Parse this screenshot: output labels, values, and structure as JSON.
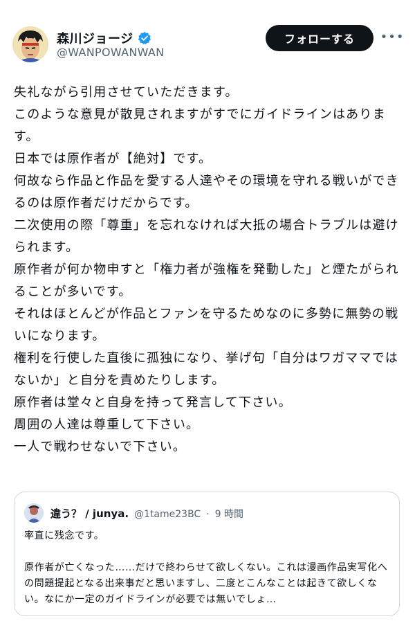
{
  "author": {
    "display_name": "森川ジョージ",
    "handle": "@WANPOWANWAN",
    "verified": true
  },
  "actions": {
    "follow_label": "フォローする",
    "more_label": "•••"
  },
  "post": {
    "lines": [
      "失礼ながら引用させていただきます。",
      "このような意見が散見されますがすでにガイドラインはあります。",
      "日本では原作者が【絶対】です。",
      "何故なら作品と作品を愛する人達やその環境を守れる戦いができるのは原作者だけだからです。",
      "二次使用の際「尊重」を忘れなければ大抵の場合トラブルは避けられます。",
      "原作者が何か物申すと「権力者が強権を発動した」と煙たがられることが多いです。",
      "それはほとんどが作品とファンを守るためなのに多勢に無勢の戦いになります。",
      "権利を行使した直後に孤独になり、挙げ句「自分はワガママではないか」と自分を責めたりします。",
      "原作者は堂々と自身を持って発言して下さい。",
      "周囲の人達は尊重して下さい。",
      "一人で戦わせないで下さい。"
    ]
  },
  "quote": {
    "display_name": "違う？ / junya.",
    "handle": "@1tame23BC",
    "separator": "·",
    "time": "9 時間",
    "line1": "率直に残念です。",
    "line2": "原作者が亡くなった……だけで終わらせて欲しくない。これは漫画作品実写化への問題提起となる出来事だと思いますし、二度とこんなことは起きて欲しくない。なにか一定のガイドラインが必要では無いでしょ…"
  },
  "colors": {
    "text": "#0f1419",
    "secondary": "#536471",
    "verified": "#1d9bf0",
    "border": "#cfd9de"
  },
  "icons": {
    "verified": "verified-badge-icon",
    "more": "more-dots-icon"
  }
}
